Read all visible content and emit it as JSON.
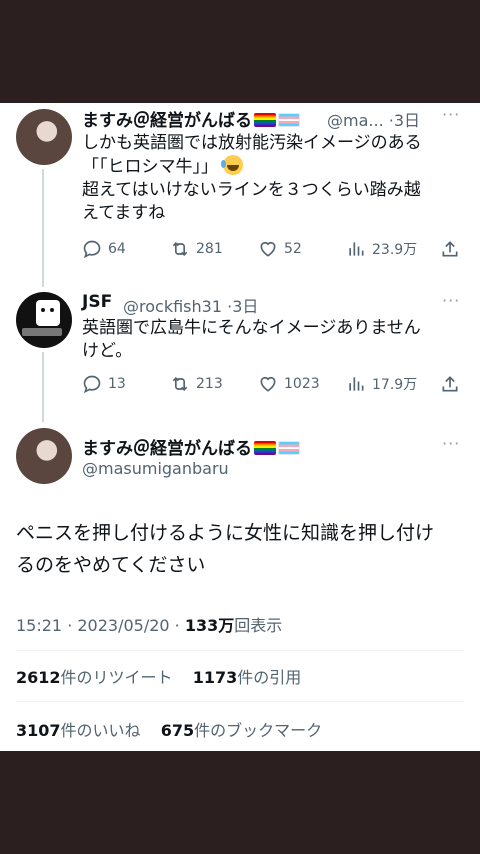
{
  "tweets": [
    {
      "name": "ますみ＠経営がんばる",
      "handle": "@ma...",
      "sep": "·",
      "time": "3日",
      "more": "···",
      "lines": [
        "しかも英語圏では放射能汚染イメージのある",
        "「「ヒロシマ牛」」",
        "超えてはいけないラインを３つくらい踏み越",
        "えてますね"
      ],
      "replies": "64",
      "retweets": "281",
      "likes": "52",
      "views": "23.9万"
    },
    {
      "name": "JSF",
      "handle": "@rockfish31",
      "sep": "·",
      "time": "3日",
      "more": "···",
      "lines": [
        "英語圏で広島牛にそんなイメージありません",
        "けど。"
      ],
      "replies": "13",
      "retweets": "213",
      "likes": "1023",
      "views": "17.9万"
    }
  ],
  "main": {
    "name": "ますみ＠経営がんばる",
    "handle": "@masumiganbaru",
    "more": "···",
    "text_line1": "ペニスを押し付けるように女性に知識を押し付け",
    "text_line2": "るのをやめてください",
    "timestamp": "15:21 · 2023/05/20 · ",
    "views_count": "133万",
    "views_label": "回表示",
    "retweet_count": "2612",
    "retweet_label": "件のリツイート",
    "quote_count": "1173",
    "quote_label": "件の引用",
    "like_count": "3107",
    "like_label": "件のいいね",
    "bookmark_count": "675",
    "bookmark_label": "件のブックマーク"
  },
  "colors": {
    "text": "#0f1419",
    "secondary": "#536471",
    "thread_line": "#cfd9de",
    "divider": "#eff3f4",
    "background_outer": "#2b1f1f"
  },
  "icons": [
    "reply-icon",
    "retweet-icon",
    "like-icon",
    "views-icon",
    "share-icon",
    "more-icon"
  ]
}
